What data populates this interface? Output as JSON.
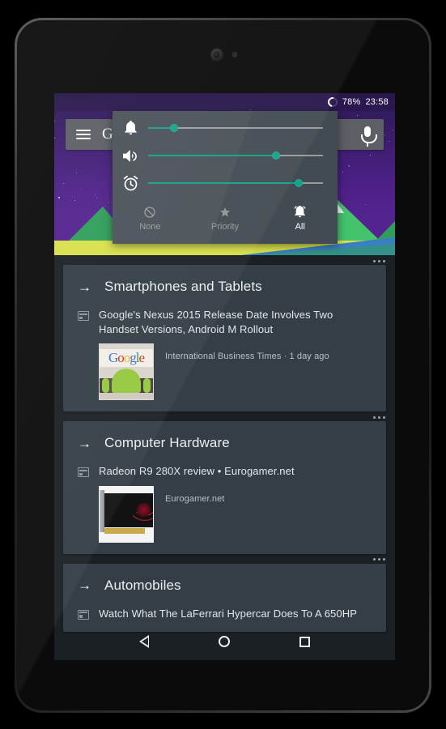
{
  "device": {
    "name": "nexus-7-tablet"
  },
  "statusbar": {
    "battery_icon": "battery-circle-icon",
    "battery_percent": "78%",
    "time": "23:58"
  },
  "searchbar": {
    "menu_icon": "hamburger-menu-icon",
    "logo_text": "Google",
    "mic_icon": "microphone-icon"
  },
  "volume_dialog": {
    "sliders": [
      {
        "icon": "bell-notification-icon",
        "label": "Notification volume",
        "value": 15
      },
      {
        "icon": "speaker-volume-icon",
        "label": "Media volume",
        "value": 73
      },
      {
        "icon": "alarm-clock-icon",
        "label": "Alarm volume",
        "value": 86
      }
    ],
    "modes": [
      {
        "icon": "block-none-icon",
        "label": "None",
        "selected": false
      },
      {
        "icon": "star-priority-icon",
        "label": "Priority",
        "selected": false
      },
      {
        "icon": "bell-all-icon",
        "label": "All",
        "selected": true
      }
    ],
    "accent_color": "#14a28a",
    "background_color": "#434b52"
  },
  "cards": [
    {
      "overflow_icon": "more-options-icon",
      "arrow_icon": "arrow-right-icon",
      "title": "Smartphones and Tablets",
      "article_icon": "news-article-icon",
      "headline": "Google's Nexus 2015 Release Date Involves Two Handset Versions, Android M Rollout",
      "thumbnail": "google-android-photo",
      "source": "International Business Times · 1 day ago"
    },
    {
      "overflow_icon": "more-options-icon",
      "arrow_icon": "arrow-right-icon",
      "title": "Computer Hardware",
      "article_icon": "news-article-icon",
      "headline": "Radeon R9 280X review • Eurogamer.net",
      "thumbnail": "radeon-gpu-photo",
      "source": "Eurogamer.net"
    },
    {
      "overflow_icon": "more-options-icon",
      "arrow_icon": "arrow-right-icon",
      "title": "Automobiles",
      "article_icon": "news-article-icon",
      "headline": "Watch What The LaFerrari Hypercar Does To A 650HP",
      "thumbnail": null,
      "source": null
    }
  ],
  "navbar": {
    "back_icon": "back-triangle-icon",
    "home_icon": "home-circle-icon",
    "recents_icon": "recents-square-icon"
  }
}
